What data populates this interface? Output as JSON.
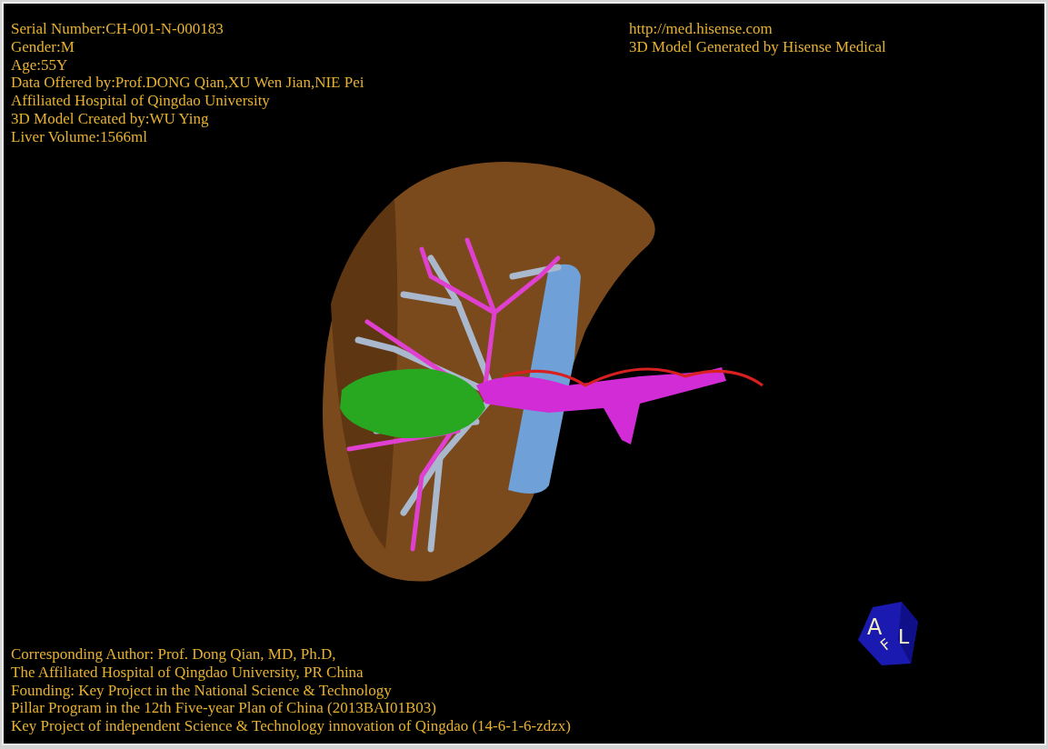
{
  "info_top_left": [
    "Serial Number:CH-001-N-000183",
    "Gender:M",
    "Age:55Y",
    "Data Offered by:Prof.DONG Qian,XU Wen Jian,NIE Pei",
    "Affiliated Hospital of Qingdao University",
    "3D Model Created by:WU Ying",
    "Liver Volume:1566ml"
  ],
  "info_top_right": [
    "http://med.hisense.com",
    "3D Model Generated by Hisense Medical"
  ],
  "info_bottom": [
    "Corresponding Author: Prof. Dong Qian, MD, Ph.D,",
    "The Affiliated Hospital of Qingdao University, PR China",
    "Founding: Key Project in the National Science & Technology",
    "Pillar Program in the 12th Five-year Plan of China (2013BAI01B03)",
    "Key Project of independent Science & Technology innovation of Qingdao (14-6-1-6-zdzx)"
  ],
  "orientation_cube": {
    "front": "A",
    "side": "L",
    "bottom": "F"
  }
}
